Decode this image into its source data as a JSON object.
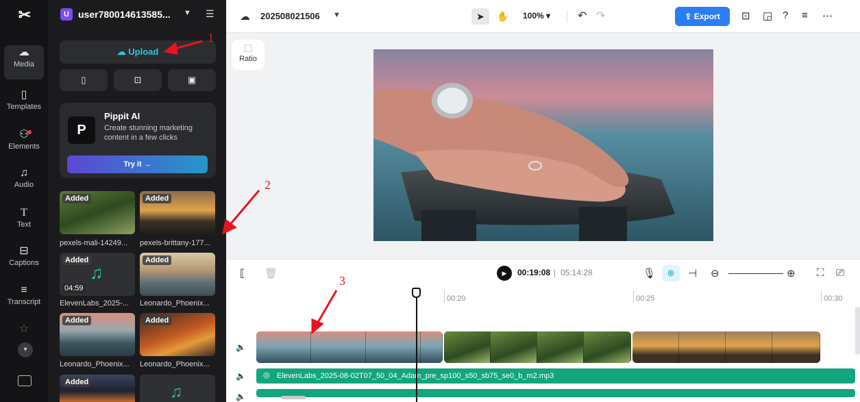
{
  "rail": {
    "items": [
      {
        "label": "Media",
        "icon": "cloud-icon"
      },
      {
        "label": "Templates",
        "icon": "templates-icon"
      },
      {
        "label": "Elements",
        "icon": "elements-icon"
      },
      {
        "label": "Audio",
        "icon": "music-note-icon"
      },
      {
        "label": "Text",
        "icon": "text-icon"
      },
      {
        "label": "Captions",
        "icon": "captions-icon"
      },
      {
        "label": "Transcript",
        "icon": "transcript-icon"
      }
    ]
  },
  "panel": {
    "username": "user780014613585...",
    "upload_label": "Upload",
    "promo": {
      "title": "Pippit AI",
      "desc": "Create stunning marketing content in a few clicks",
      "try_label": "Try it →"
    },
    "media": [
      {
        "name": "pexels-mali-14249...",
        "badge": "Added",
        "duration": ""
      },
      {
        "name": "pexels-brittany-177...",
        "badge": "Added",
        "duration": ""
      },
      {
        "name": "ElevenLabs_2025-...",
        "badge": "Added",
        "duration": "04:59"
      },
      {
        "name": "Leonardo_Phoenix...",
        "badge": "Added",
        "duration": ""
      },
      {
        "name": "Leonardo_Phoenix...",
        "badge": "Added",
        "duration": ""
      },
      {
        "name": "Leonardo_Phoenix...",
        "badge": "Added",
        "duration": ""
      },
      {
        "name": "",
        "badge": "Added",
        "duration": ""
      },
      {
        "name": "",
        "badge": "",
        "duration": ""
      }
    ]
  },
  "topbar": {
    "project_name": "202508021506",
    "zoom": "100%",
    "export_label": "Export"
  },
  "canvas": {
    "ratio_label": "Ratio"
  },
  "timeline": {
    "current_time": "00:19:08",
    "separator": "|",
    "total_time": "05:14:28",
    "ruler": [
      "00:20",
      "00:25",
      "00:30"
    ],
    "audio_label": "ElevenLabs_2025-08-02T07_50_04_Adam_pre_sp100_s50_sb75_se0_b_m2.mp3"
  },
  "annotations": [
    "1",
    "2",
    "3"
  ],
  "colors": {
    "accent": "#2a7df4",
    "upload_text": "#2ec6d8",
    "audio_track": "#13a57d",
    "annotation": "#e8141f"
  }
}
